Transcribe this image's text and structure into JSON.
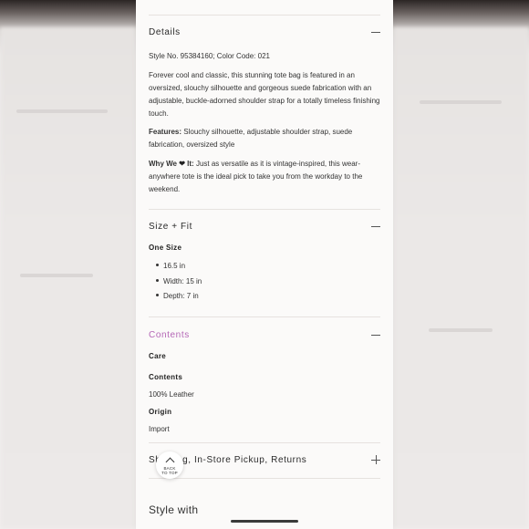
{
  "details": {
    "title": "Details",
    "style_line": "Style No. 95384160; Color Code: 021",
    "description": "Forever cool and classic, this stunning tote bag is featured in an oversized, slouchy silhouette and gorgeous suede fabrication with an adjustable, buckle-adorned shoulder strap for a totally timeless finishing touch.",
    "features_label": "Features:",
    "features_text": "Slouchy silhouette, adjustable shoulder strap, suede fabrication, oversized style",
    "why_label_prefix": "Why We",
    "why_label_suffix": "It:",
    "why_text": "Just as versatile as it is vintage-inspired, this wear-anywhere tote is the ideal pick to take you from the workday to the weekend."
  },
  "size_fit": {
    "title": "Size + Fit",
    "one_size_label": "One Size",
    "items": [
      "16.5 in",
      "Width: 15 in",
      "Depth: 7 in"
    ]
  },
  "contents": {
    "title": "Contents",
    "care_label": "Care",
    "contents_label": "Contents",
    "contents_value": "100% Leather",
    "origin_label": "Origin",
    "origin_value": "Import"
  },
  "shipping": {
    "title": "Shipping, In-Store Pickup, Returns",
    "visible_title": "Sh       g, In-Store Pickup, Returns"
  },
  "back_to_top": {
    "line1": "BACK",
    "line2": "TO TOP"
  },
  "style_with": "Style with",
  "icons": {
    "expanded": "minus-icon",
    "collapsed": "plus-icon",
    "heart": "heart-icon"
  },
  "colors": {
    "accent": "#b466b6"
  }
}
